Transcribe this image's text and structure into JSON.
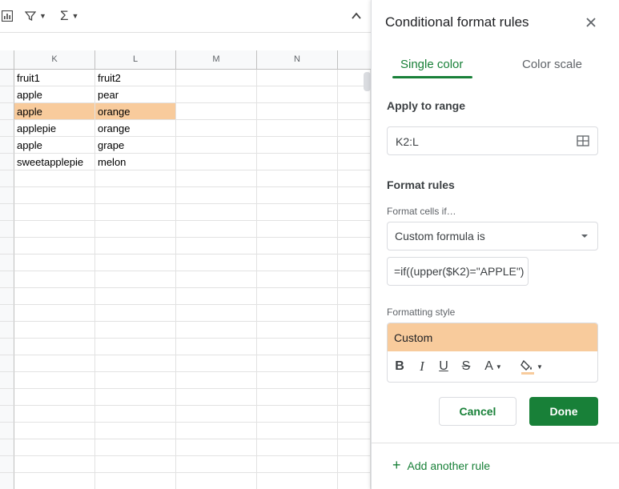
{
  "sheet": {
    "columns": [
      "K",
      "L",
      "M",
      "N"
    ],
    "rows": [
      {
        "k": "fruit1",
        "l": "fruit2",
        "highlight": false
      },
      {
        "k": "apple",
        "l": "pear",
        "highlight": false
      },
      {
        "k": "apple",
        "l": "orange",
        "highlight": true
      },
      {
        "k": "applepie",
        "l": "orange",
        "highlight": false
      },
      {
        "k": "apple",
        "l": "grape",
        "highlight": false
      },
      {
        "k": "sweetapplepie",
        "l": "melon",
        "highlight": false
      }
    ],
    "highlight_color": "#f8cb9c"
  },
  "panel": {
    "title": "Conditional format rules",
    "tabs": {
      "single": "Single color",
      "scale": "Color scale"
    },
    "apply_label": "Apply to range",
    "range_value": "K2:L",
    "format_rules_label": "Format rules",
    "format_cells_if_label": "Format cells if…",
    "condition_value": "Custom formula is",
    "formula_value": "=if((upper($K2)=\"APPLE\")",
    "formatting_style_label": "Formatting style",
    "style_preview": "Custom",
    "style_color": "#f8cb9c",
    "cancel_label": "Cancel",
    "done_label": "Done",
    "add_rule_label": "Add another rule",
    "accent_color": "#188038"
  }
}
